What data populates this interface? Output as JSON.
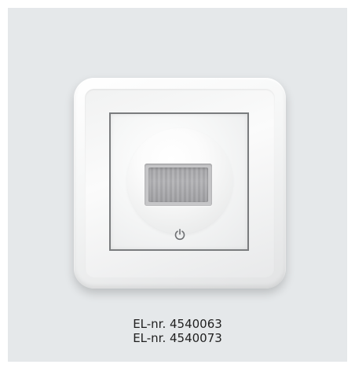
{
  "product": {
    "image_description_icon": "motion-sensor-switch-icon",
    "power_icon": "power-icon",
    "el_numbers": [
      "EL-nr. 4540063",
      "EL-nr. 4540073"
    ]
  },
  "colors": {
    "background_panel": "#e5e8ea",
    "frame": "#f4f5f5",
    "insert_outline": "#7a7c7e",
    "sensor_window": "#a7a7aa",
    "text": "#1f1f1f"
  }
}
